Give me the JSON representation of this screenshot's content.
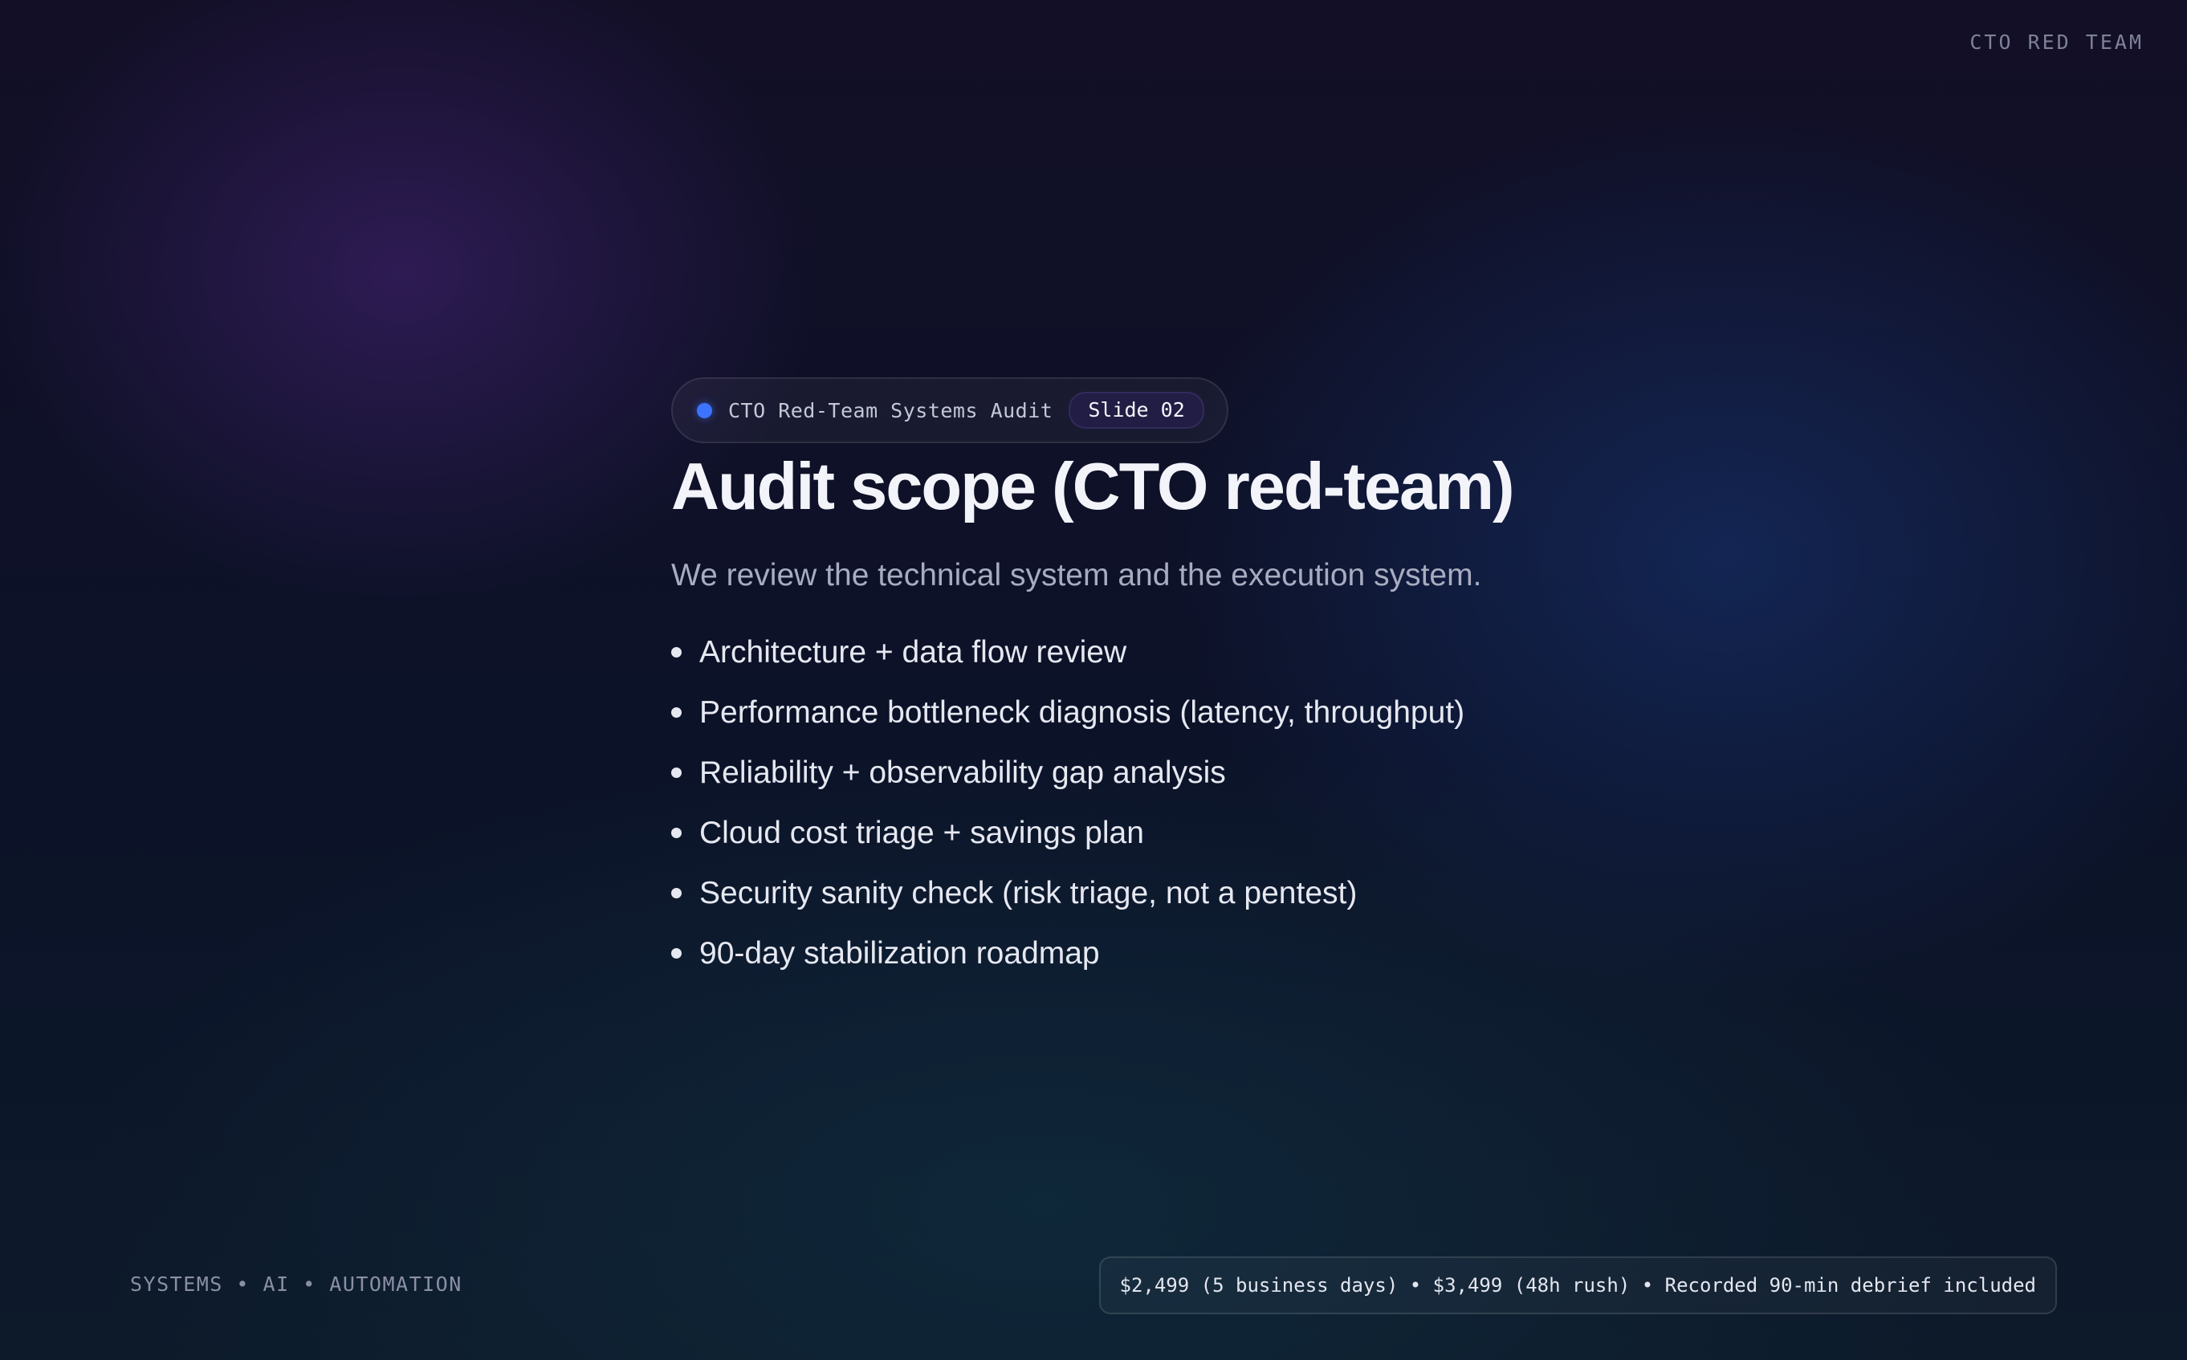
{
  "header": {
    "brand": "CTO RED TEAM"
  },
  "slide": {
    "pill_label": "CTO Red-Team Systems Audit",
    "slide_badge": "Slide 02",
    "title": "Audit scope (CTO red-team)",
    "subtitle": "We review the technical system and the execution system.",
    "bullets": [
      "Architecture + data flow review",
      "Performance bottleneck diagnosis (latency, throughput)",
      "Reliability + observability gap analysis",
      "Cloud cost triage + savings plan",
      "Security sanity check (risk triage, not a pentest)",
      "90-day stabilization roadmap"
    ]
  },
  "footer": {
    "tagline": "SYSTEMS • AI • AUTOMATION",
    "pricing": "$2,499 (5 business days) • $3,499 (48h rush) • Recorded 90-min debrief included"
  },
  "colors": {
    "accent_dot": "#3d74ff",
    "background": "#0c1228"
  }
}
